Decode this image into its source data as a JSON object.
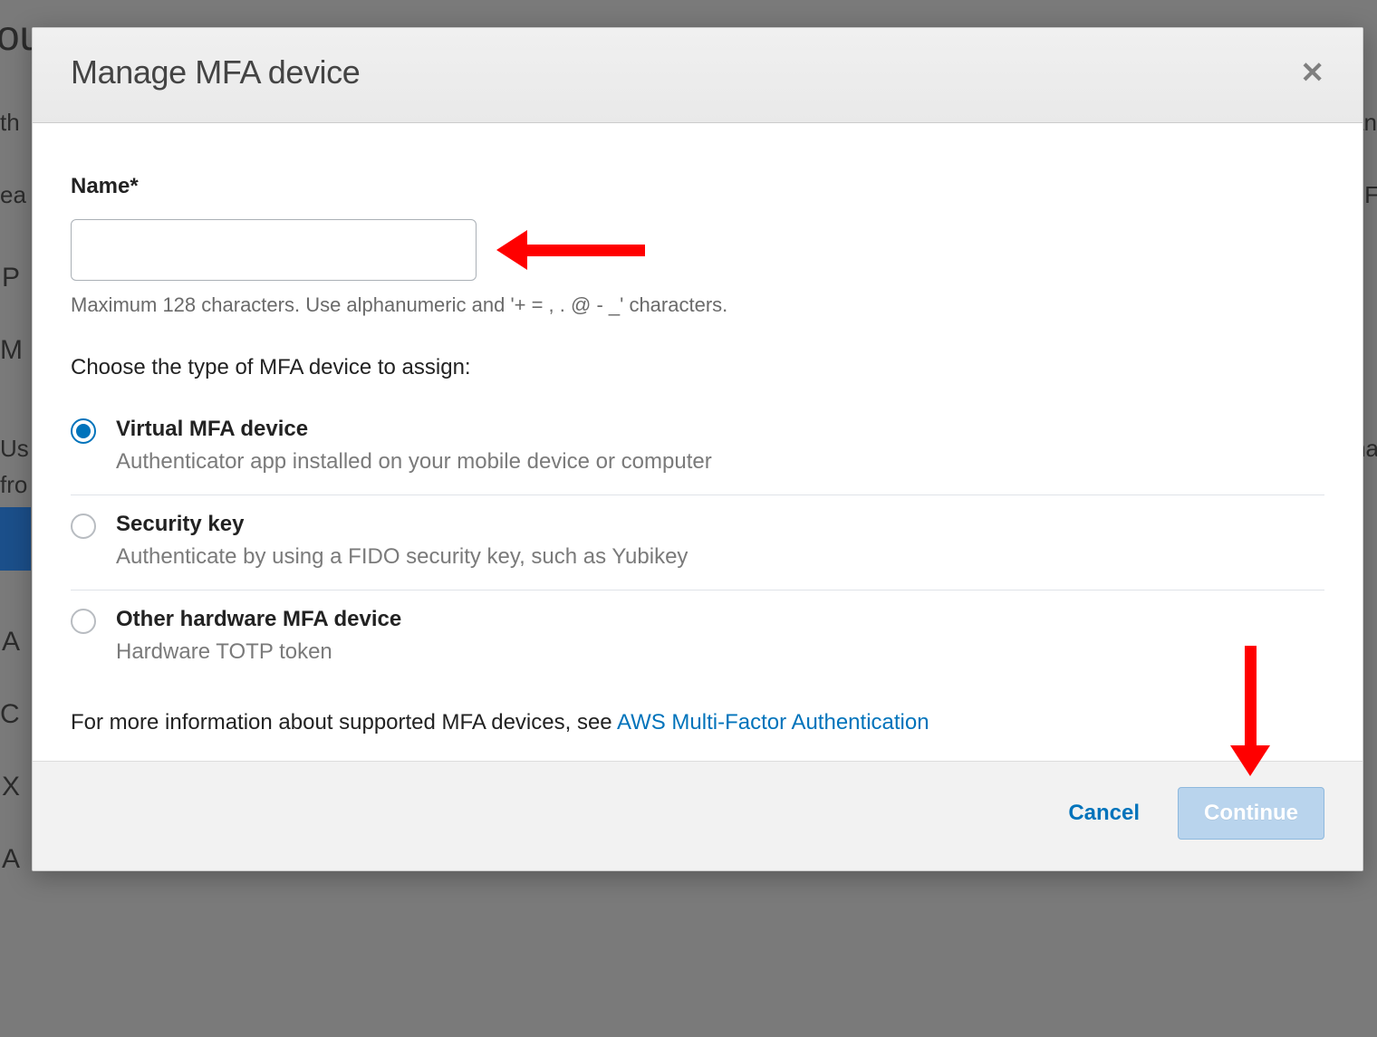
{
  "modal": {
    "title": "Manage MFA device",
    "close_label": "✕",
    "name_label": "Name*",
    "name_value": "",
    "name_helper": "Maximum 128 characters. Use alphanumeric and '+ = , . @ - _' characters.",
    "choose_label": "Choose the type of MFA device to assign:",
    "options": [
      {
        "title": "Virtual MFA device",
        "desc": "Authenticator app installed on your mobile device or computer",
        "selected": true
      },
      {
        "title": "Security key",
        "desc": "Authenticate by using a FIDO security key, such as Yubikey",
        "selected": false
      },
      {
        "title": "Other hardware MFA device",
        "desc": "Hardware TOTP token",
        "selected": false
      }
    ],
    "info_text": "For more information about supported MFA devices, see ",
    "info_link": "AWS Multi-Factor Authentication",
    "cancel_label": "Cancel",
    "continue_label": "Continue"
  },
  "background_fragments": [
    "ou",
    "th",
    "an",
    "ea",
    "al F",
    "P",
    "M",
    "Us",
    "na",
    "fro",
    "A",
    "C",
    "X",
    "A"
  ]
}
